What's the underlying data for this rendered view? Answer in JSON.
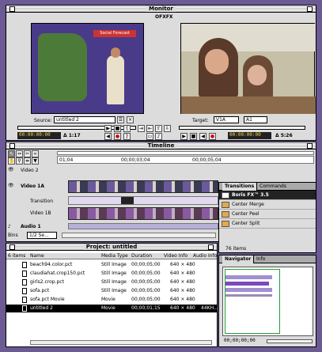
{
  "monitor": {
    "title": "Monitor",
    "marker": "OFXFX",
    "source_label": "Source:",
    "source_value": "untitled 2",
    "source_tc": "00:00:00:00",
    "source_dur": "Δ 1:17",
    "target_label": "Target:",
    "target_v": "V1A",
    "target_a": "A1",
    "program_tc": "00:00:00:00",
    "program_dur": "Δ 5:26",
    "weather_graphic": "Social Forecast"
  },
  "timeline": {
    "title": "Timeline",
    "ruler": [
      "01;04",
      "00;00;03;04",
      "00;00;05;04"
    ],
    "tracks": {
      "video2": "Video 2",
      "video1a": "Video 1A",
      "transition": "Transition",
      "video1b": "Video 1B",
      "audio1": "Audio 1"
    },
    "bins_label": "Bins",
    "zoom_label": "1/2 Se..."
  },
  "transitions": {
    "tab_active": "Transitions",
    "tab_other": "Commands",
    "items": [
      "Boris FX™ 3.5",
      "Center Merge",
      "Center Peel",
      "Center Split"
    ],
    "count": "76 items"
  },
  "project": {
    "title": "Project: untitled",
    "headers": [
      "6 items",
      "Name",
      "Media Type",
      "Duration",
      "Video Info",
      "Audio Info"
    ],
    "rows": [
      {
        "name": "beach94.color.pct",
        "type": "Still Image",
        "dur": "00;00;05;00",
        "vinfo": "640 × 480",
        "ainfo": ""
      },
      {
        "name": "claudiahat.crop150.pct",
        "type": "Still Image",
        "dur": "00;00;05;00",
        "vinfo": "640 × 480",
        "ainfo": ""
      },
      {
        "name": "girls2.crop.pct",
        "type": "Still Image",
        "dur": "00;00;05;00",
        "vinfo": "640 × 480",
        "ainfo": ""
      },
      {
        "name": "sofa.pct",
        "type": "Still Image",
        "dur": "00;00;05;00",
        "vinfo": "640 × 480",
        "ainfo": ""
      },
      {
        "name": "sofa.pct Movie",
        "type": "Movie",
        "dur": "00;00;05;00",
        "vinfo": "640 × 480",
        "ainfo": ""
      },
      {
        "name": "untitled 2",
        "type": "Movie",
        "dur": "00;00;01;15",
        "vinfo": "640 × 480",
        "ainfo": "44KH..."
      }
    ]
  },
  "navigator": {
    "tab_active": "Navigator",
    "tab_other": "Info",
    "tc": "00;00;00;00"
  }
}
